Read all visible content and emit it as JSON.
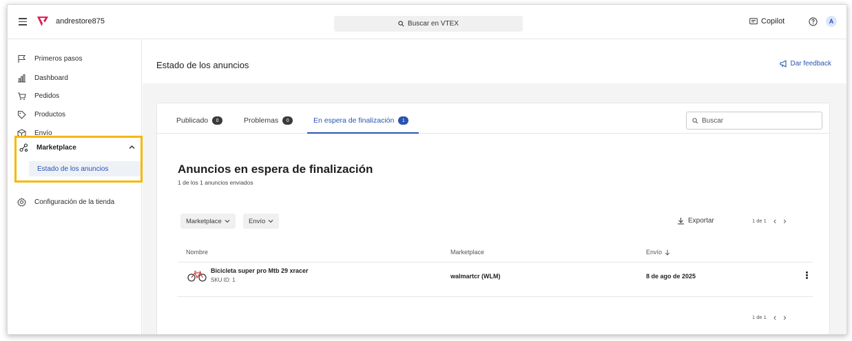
{
  "topbar": {
    "store_name": "andrestore875",
    "search_label": "Buscar en VTEX",
    "copilot_label": "Copilot",
    "avatar_letter": "A",
    "brand_color": "#e31c58"
  },
  "sidebar": {
    "items": [
      {
        "label": "Primeros pasos",
        "icon": "flag-icon"
      },
      {
        "label": "Dashboard",
        "icon": "bar-chart-icon"
      },
      {
        "label": "Pedidos",
        "icon": "cart-icon"
      },
      {
        "label": "Productos",
        "icon": "tag-icon"
      },
      {
        "label": "Envío",
        "icon": "box-icon"
      }
    ],
    "marketplace": {
      "label": "Marketplace",
      "icon": "share-icon",
      "sub_item": "Estado de los anuncios"
    },
    "store_config": {
      "label": "Configuración de la tienda",
      "icon": "gear-icon"
    },
    "highlight_color": "#f5b800"
  },
  "page": {
    "title": "Estado de los anuncios",
    "feedback_label": "Dar feedback"
  },
  "tabs": [
    {
      "label": "Publicado",
      "count": "0",
      "active": false
    },
    {
      "label": "Problemas",
      "count": "0",
      "active": false
    },
    {
      "label": "En espera de finalización",
      "count": "1",
      "active": true
    }
  ],
  "search": {
    "placeholder": "Buscar"
  },
  "section": {
    "title": "Anuncios en espera de finalización",
    "subtitle": "1 de los 1 anuncios enviados"
  },
  "filters": [
    {
      "label": "Marketplace"
    },
    {
      "label": "Envío"
    }
  ],
  "export_label": "Exportar",
  "pagination": {
    "label": "1 de 1"
  },
  "table": {
    "columns": [
      "Nombre",
      "Marketplace",
      "Envío"
    ],
    "rows": [
      {
        "name": "Bicicleta super pro Mtb 29 xracer",
        "sku": "SKU ID: 1",
        "marketplace": "walmartcr (WLM)",
        "shipping": "8 de ago de 2025"
      }
    ]
  },
  "accent_color": "#2953b2"
}
